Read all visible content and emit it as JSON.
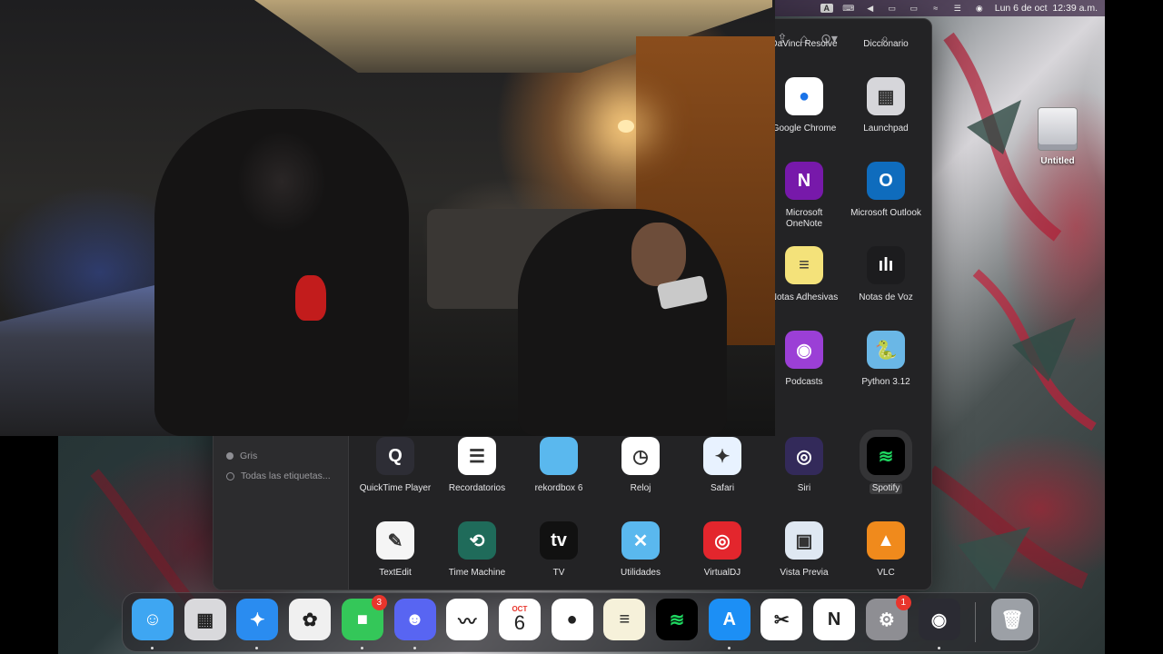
{
  "menubar": {
    "input_indicator": "A",
    "datetime": "Lun 6 de oct  12:39 a.m."
  },
  "desktop": {
    "drive_label": "Untitled"
  },
  "finder": {
    "sidebar_tags": [
      "Gris",
      "Todas las etiquetas..."
    ],
    "apps": [
      {
        "name": "DaVinci Resolve",
        "icon": "davinci-resolve-icon"
      },
      {
        "name": "Diccionario",
        "icon": "dictionary-icon"
      },
      {
        "name": "Google Chrome",
        "icon": "chrome-icon",
        "glyph": "●"
      },
      {
        "name": "Launchpad",
        "icon": "launchpad-icon",
        "glyph": "▦"
      },
      {
        "name": "Microsoft\nOneNote",
        "icon": "onenote-icon",
        "glyph": "N"
      },
      {
        "name": "Microsoft Outlook",
        "icon": "outlook-icon",
        "glyph": "O"
      },
      {
        "name": "Notas Adhesivas",
        "icon": "stickies-icon",
        "glyph": "≡"
      },
      {
        "name": "Notas de Voz",
        "icon": "voice-memos-icon",
        "glyph": "ılı"
      },
      {
        "name": "Podcasts",
        "icon": "podcasts-icon",
        "glyph": "◉"
      },
      {
        "name": "Python 3.12",
        "icon": "python-folder-icon",
        "glyph": "🐍"
      },
      {
        "name": "QuickTime Player",
        "icon": "quicktime-icon",
        "glyph": "Q"
      },
      {
        "name": "Recordatorios",
        "icon": "reminders-icon",
        "glyph": "☰"
      },
      {
        "name": "rekordbox 6",
        "icon": "folder-icon",
        "glyph": ""
      },
      {
        "name": "Reloj",
        "icon": "clock-icon",
        "glyph": "◷"
      },
      {
        "name": "Safari",
        "icon": "safari-icon",
        "glyph": "✦"
      },
      {
        "name": "Siri",
        "icon": "siri-icon",
        "glyph": "◎"
      },
      {
        "name": "Spotify",
        "icon": "spotify-icon",
        "glyph": "≋"
      },
      {
        "name": "TextEdit",
        "icon": "textedit-icon",
        "glyph": "✎"
      },
      {
        "name": "Time Machine",
        "icon": "time-machine-icon",
        "glyph": "⟲"
      },
      {
        "name": "TV",
        "icon": "apple-tv-icon",
        "glyph": "tv"
      },
      {
        "name": "Utilidades",
        "icon": "utilities-folder-icon",
        "glyph": "✕"
      },
      {
        "name": "VirtualDJ",
        "icon": "virtualdj-icon",
        "glyph": "◎"
      },
      {
        "name": "Vista Previa",
        "icon": "preview-icon",
        "glyph": "▣"
      },
      {
        "name": "VLC",
        "icon": "vlc-icon",
        "glyph": "▲"
      }
    ],
    "selected_app": "Spotify"
  },
  "dock": {
    "items": [
      {
        "name": "finder",
        "color": "#3ea6f2",
        "glyph": "☺"
      },
      {
        "name": "launchpad",
        "color": "#d9d9dc",
        "glyph": "▦"
      },
      {
        "name": "safari",
        "color": "#2a8cf0",
        "glyph": "✦"
      },
      {
        "name": "photos",
        "color": "#f0f0f0",
        "glyph": "✿"
      },
      {
        "name": "facetime",
        "color": "#34c759",
        "glyph": "■",
        "badge": "3"
      },
      {
        "name": "discord",
        "color": "#5865f2",
        "glyph": "☻"
      },
      {
        "name": "freeform",
        "color": "#ffffff",
        "glyph": "〰"
      },
      {
        "name": "calendar",
        "color": "#ffffff",
        "glyph": "6",
        "month": "OCT"
      },
      {
        "name": "chrome",
        "color": "#ffffff",
        "glyph": "●"
      },
      {
        "name": "notes",
        "color": "#f6f1da",
        "glyph": "≡"
      },
      {
        "name": "spotify",
        "color": "#000000",
        "glyph": "≋"
      },
      {
        "name": "app-store",
        "color": "#1c8ff5",
        "glyph": "A"
      },
      {
        "name": "capcut",
        "color": "#ffffff",
        "glyph": "✂"
      },
      {
        "name": "notion",
        "color": "#ffffff",
        "glyph": "N"
      },
      {
        "name": "system-settings",
        "color": "#8e8e93",
        "glyph": "⚙",
        "badge": "1"
      },
      {
        "name": "obs",
        "color": "#2b2b33",
        "glyph": "◉"
      },
      {
        "name": "trash",
        "color": "#9ca0a6",
        "glyph": "🗑"
      }
    ]
  }
}
